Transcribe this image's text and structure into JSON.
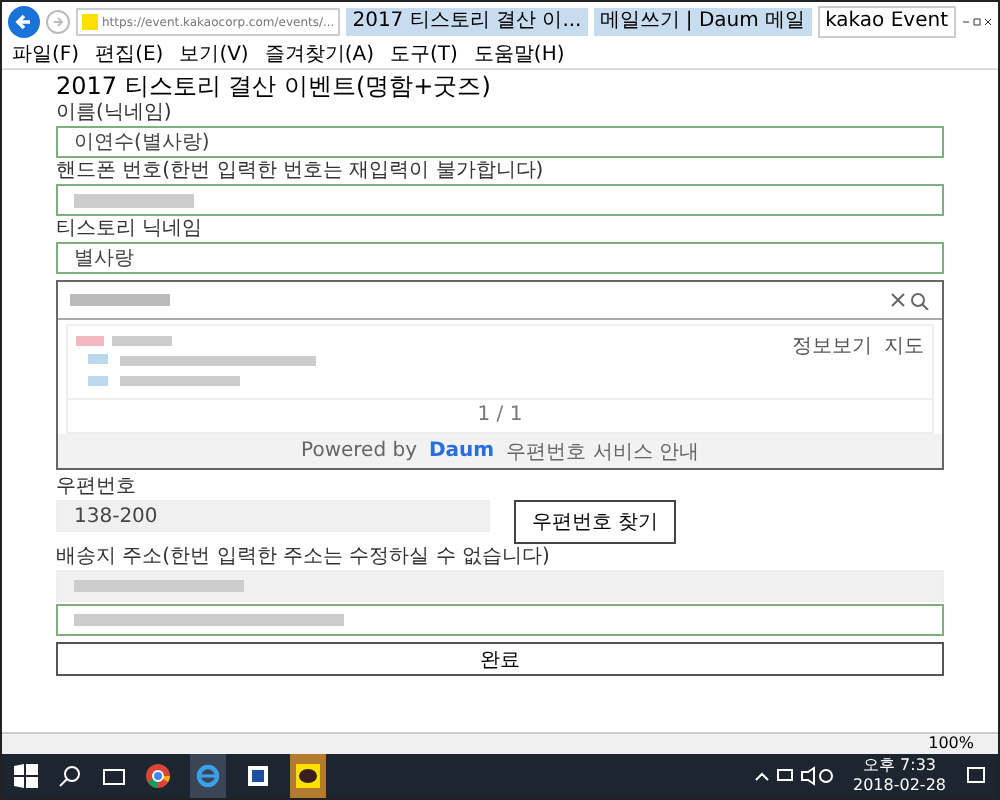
{
  "browser": {
    "url": "https://event.kakaocorp.com/events/...",
    "tabs": [
      {
        "label": "2017 티스토리 결산 이...",
        "selected": false
      },
      {
        "label": "메일쓰기 | Daum 메일",
        "selected": false
      },
      {
        "label": "kakao Event",
        "selected": true
      }
    ],
    "menu": [
      "파일(F)",
      "편집(E)",
      "보기(V)",
      "즐겨찾기(A)",
      "도구(T)",
      "도움말(H)"
    ]
  },
  "form": {
    "title": "2017 티스토리 결산 이벤트(명함+굿즈)",
    "name": {
      "label": "이름(닉네임)",
      "value": "이연수(별사랑)"
    },
    "phone": {
      "label": "핸드폰 번호(한번 입력한 번호는 재입력이 불가합니다)"
    },
    "nickname": {
      "label": "티스토리 닉네임",
      "value": "별사랑"
    },
    "postcode_popup": {
      "actions": [
        "정보보기",
        "지도"
      ],
      "pager": "1 / 1",
      "powered_by": "Powered by",
      "brand": "Daum",
      "service_link": "우편번호 서비스 안내"
    },
    "postcode": {
      "label": "우편번호",
      "value": "138-200",
      "button": "우편번호 찾기"
    },
    "address": {
      "label": "배송지 주소(한번 입력한 주소는 수정하실 수 없습니다)"
    },
    "submit": "완료"
  },
  "status_bar": {
    "zoom": "100%"
  },
  "taskbar": {
    "time": "오후 7:33",
    "date": "2018-02-28"
  }
}
